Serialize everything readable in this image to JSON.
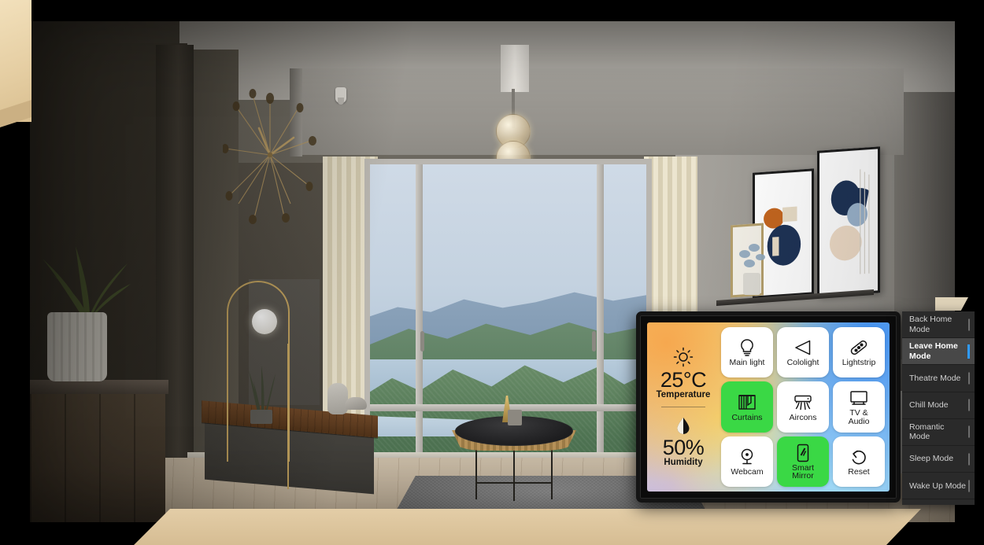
{
  "scene": {
    "description": "Smart home living room with floor-to-ceiling window overlooking mountains and a lake"
  },
  "control_panel": {
    "environment": {
      "temperature": {
        "icon": "sun-icon",
        "value": "25°C",
        "label": "Temperature"
      },
      "humidity": {
        "icon": "water-drop-icon",
        "value": "50%",
        "label": "Humidity"
      }
    },
    "tiles": [
      {
        "label": "Main light",
        "icon": "lightbulb-icon",
        "active": false
      },
      {
        "label": "Cololight",
        "icon": "triangle-icon",
        "active": false
      },
      {
        "label": "Lightstrip",
        "icon": "lightstrip-icon",
        "active": false
      },
      {
        "label": "Curtains",
        "icon": "curtains-icon",
        "active": true
      },
      {
        "label": "Aircons",
        "icon": "aircon-icon",
        "active": false
      },
      {
        "label": "TV &\nAudio",
        "icon": "television-icon",
        "active": false
      },
      {
        "label": "Webcam",
        "icon": "webcam-icon",
        "active": false
      },
      {
        "label": "Smart\nMirror",
        "icon": "mirror-icon",
        "active": true
      },
      {
        "label": "Reset",
        "icon": "undo-arrow-icon",
        "active": false
      }
    ]
  },
  "mode_list": {
    "items": [
      {
        "label": "Back Home Mode",
        "selected": false
      },
      {
        "label": "Leave Home Mode",
        "selected": true
      },
      {
        "label": "Theatre Mode",
        "selected": false
      },
      {
        "label": "Chill Mode",
        "selected": false
      },
      {
        "label": "Romantic Mode",
        "selected": false
      },
      {
        "label": "Sleep Mode",
        "selected": false
      },
      {
        "label": "Wake Up Mode",
        "selected": false
      }
    ]
  },
  "colors": {
    "active_tile": "#3ad845",
    "selected_mode_indicator": "#2f9bff",
    "mode_list_bg": "#2a2a2a",
    "accent_tan": "#e3cda7"
  }
}
